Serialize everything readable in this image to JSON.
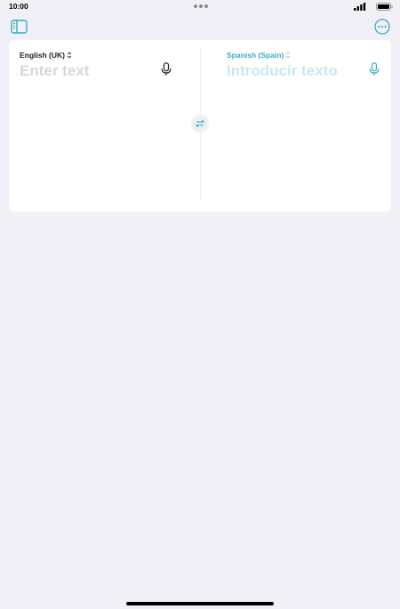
{
  "status_bar": {
    "time": "10:00",
    "signal_icon": "signal-icon",
    "battery_icon": "battery-icon"
  },
  "toolbar": {
    "sidebar_icon": "sidebar-icon",
    "more_icon": "ellipsis-circle-icon"
  },
  "source": {
    "language": "English (UK)",
    "placeholder": "Enter text",
    "value": ""
  },
  "target": {
    "language": "Spanish (Spain)",
    "placeholder": "Introducir texto",
    "value": ""
  },
  "colors": {
    "accent": "#36aac6",
    "background": "#f1f0f6",
    "card": "#ffffff"
  }
}
